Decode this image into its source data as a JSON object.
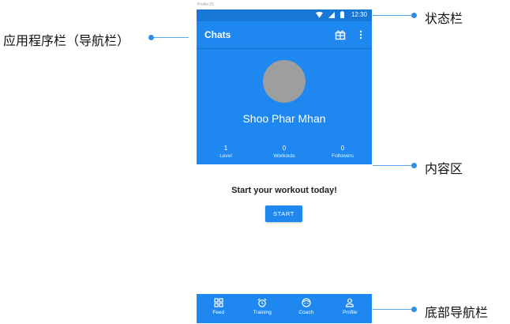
{
  "frame_label": "Profile 01",
  "status_bar": {
    "time": "12:30",
    "icons": [
      "wifi-icon",
      "signal-icon",
      "battery-icon"
    ]
  },
  "app_bar": {
    "title": "Chats",
    "actions": [
      "gift-icon",
      "more-vert-icon"
    ]
  },
  "profile": {
    "name": "Shoo Phar Mhan",
    "stats": [
      {
        "value": "1",
        "label": "Level"
      },
      {
        "value": "0",
        "label": "Workouts"
      },
      {
        "value": "0",
        "label": "Followers"
      }
    ]
  },
  "content": {
    "prompt": "Start your workout today!",
    "button_label": "START"
  },
  "bottom_nav": [
    {
      "label": "Feed",
      "icon": "grid-icon"
    },
    {
      "label": "Training",
      "icon": "alarm-clock-icon"
    },
    {
      "label": "Coach",
      "icon": "face-icon"
    },
    {
      "label": "Profile",
      "icon": "person-icon"
    }
  ],
  "annotations": {
    "status_bar": "状态栏",
    "app_bar": "应用程序栏（导航栏）",
    "content": "内容区",
    "bottom_nav": "底部导航栏"
  },
  "colors": {
    "primary": "#1e88f0",
    "status": "#1777d6",
    "avatar": "#9e9e9e",
    "annotation": "#2f8de6"
  }
}
